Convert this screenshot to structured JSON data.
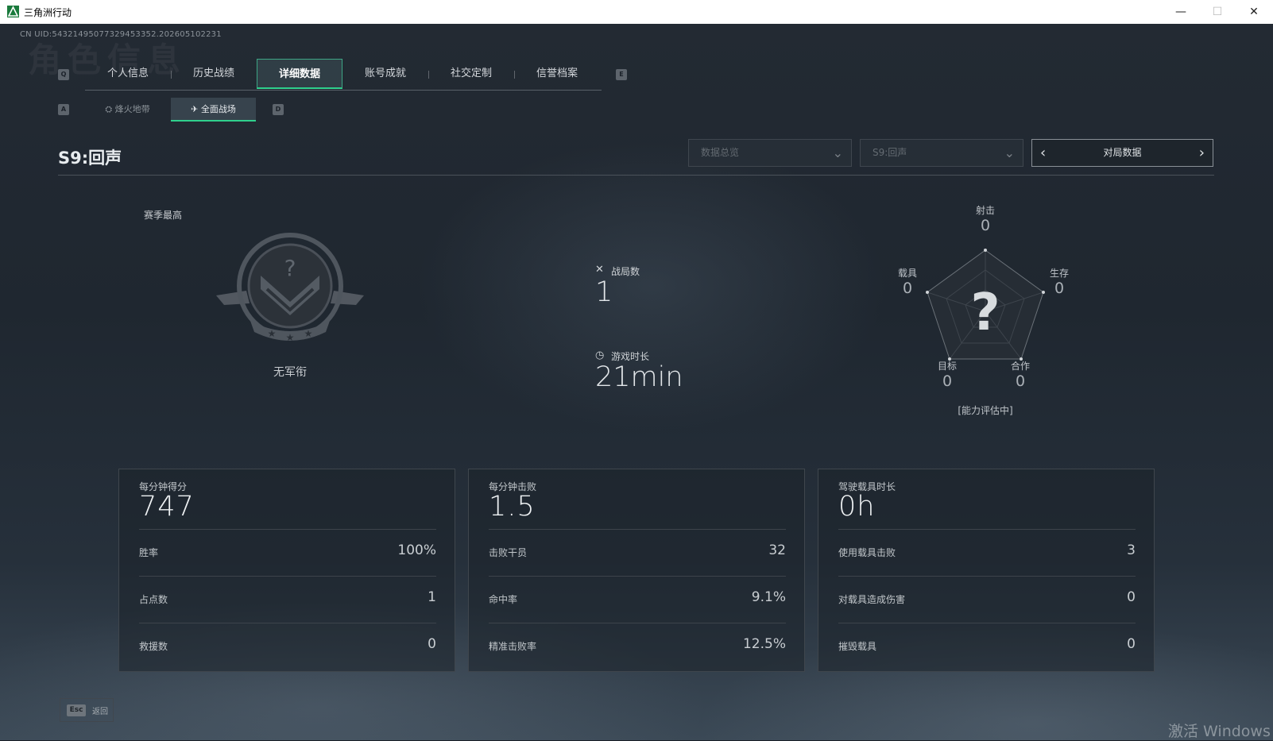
{
  "window": {
    "title": "三角洲行动",
    "minimize": "—",
    "maximize": "☐",
    "close": "✕"
  },
  "uid": "CN UID:543214950773294533​52.202605102231",
  "bg_title": "角色信息",
  "tabs": {
    "prev_key": "Q",
    "next_key": "E",
    "items": [
      {
        "label": "个人信息"
      },
      {
        "label": "历史战绩"
      },
      {
        "label": "详细数据",
        "active": true
      },
      {
        "label": "账号成就"
      },
      {
        "label": "社交定制"
      },
      {
        "label": "信誉档案"
      }
    ]
  },
  "subtabs": {
    "prev_key": "A",
    "next_key": "D",
    "items": [
      {
        "label": "烽火地带"
      },
      {
        "label": "全面战场",
        "active": true
      }
    ]
  },
  "season": "S9:回声",
  "filters": {
    "mode": "数据总览",
    "season": "S9:回声",
    "pager_label": "对局数据"
  },
  "rank": {
    "heading": "赛季最高",
    "name": "无军衔"
  },
  "overview": {
    "matches_label": "战局数",
    "matches_value": "1",
    "playtime_label": "游戏时长",
    "playtime_value": "21min"
  },
  "radar": {
    "shooting_label": "射击",
    "shooting_value": "0",
    "survival_label": "生存",
    "survival_value": "0",
    "teamwork_label": "合作",
    "teamwork_value": "0",
    "objective_label": "目标",
    "objective_value": "0",
    "vehicle_label": "载具",
    "vehicle_value": "0",
    "note": "[能力评估中]"
  },
  "cards": [
    {
      "title": "每分钟得分",
      "big": "747",
      "rows": [
        {
          "label": "胜率",
          "value": "100%"
        },
        {
          "label": "占点数",
          "value": "1"
        },
        {
          "label": "救援数",
          "value": "0"
        }
      ]
    },
    {
      "title": "每分钟击败",
      "big": "1.5",
      "rows": [
        {
          "label": "击败干员",
          "value": "32"
        },
        {
          "label": "命中率",
          "value": "9.1%"
        },
        {
          "label": "精准击败率",
          "value": "12.5%"
        }
      ]
    },
    {
      "title": "驾驶载具时长",
      "big": "0h",
      "rows": [
        {
          "label": "使用载具击败",
          "value": "3"
        },
        {
          "label": "对载具造成伤害",
          "value": "0"
        },
        {
          "label": "摧毁载具",
          "value": "0"
        }
      ]
    }
  ],
  "footer": {
    "esc_key": "Esc",
    "back_label": "返回"
  },
  "watermark": "激活 Windows",
  "colors": {
    "accent": "#2fd08d",
    "background": "#1f2730"
  }
}
